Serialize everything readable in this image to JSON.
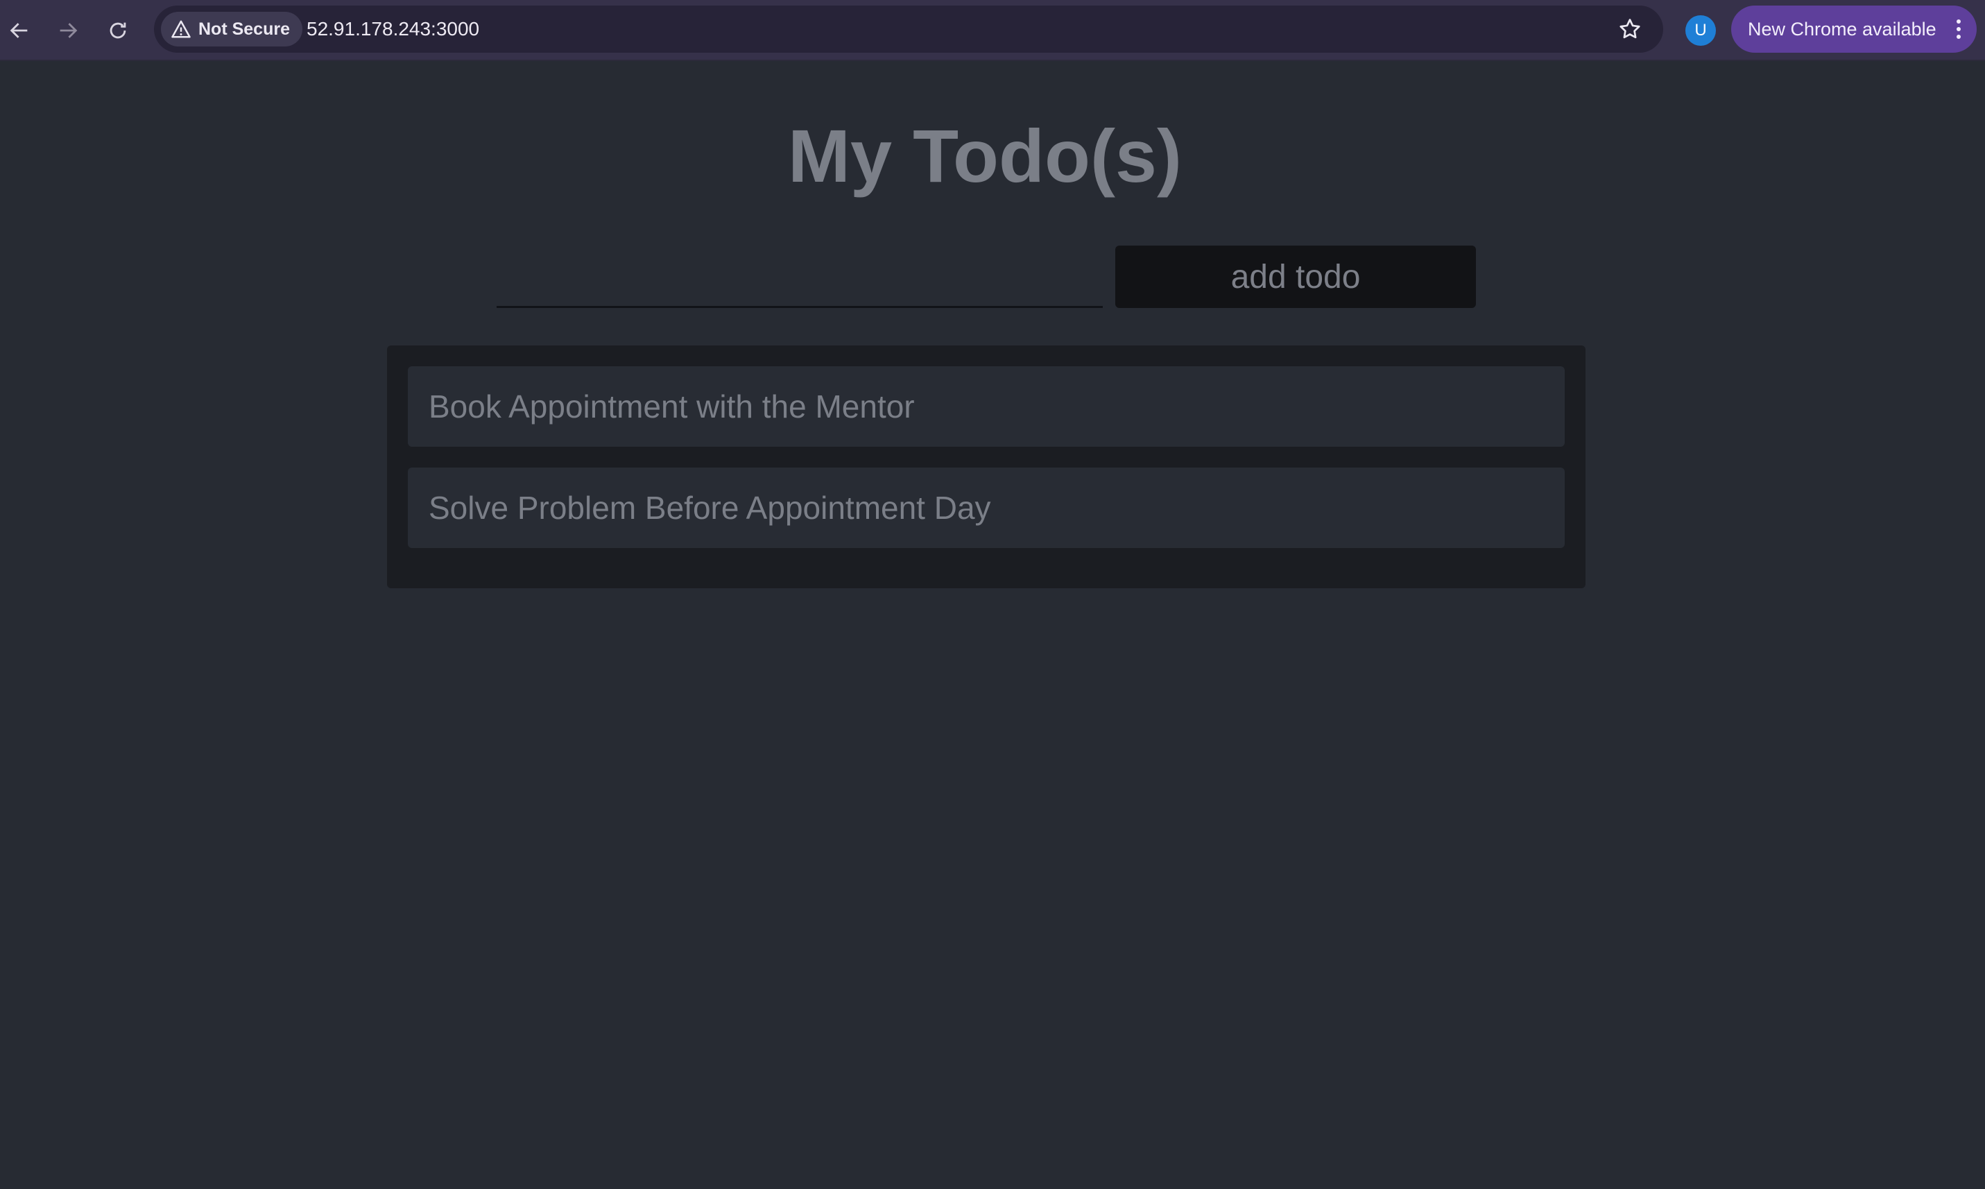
{
  "browser": {
    "security_label": "Not Secure",
    "url": "52.91.178.243:3000",
    "profile_initial": "U",
    "update_label": "New Chrome available"
  },
  "icons": {
    "back": "arrow-left-icon",
    "forward": "arrow-right-icon",
    "reload": "reload-icon",
    "security": "warning-triangle-icon",
    "bookmark": "star-icon",
    "menu": "kebab-menu-icon"
  },
  "colors": {
    "page_background": "#272b33",
    "panel_background": "#1b1d22",
    "item_background": "#282c34",
    "button_background": "#121316",
    "text": "#7b7f88",
    "update_chip": "#5e3f9b",
    "avatar": "#1f7fd6"
  },
  "app": {
    "title": "My Todo(s)",
    "input_value": "",
    "add_button_label": "add todo",
    "todos": [
      {
        "text": "Book Appointment with the Mentor"
      },
      {
        "text": "Solve Problem Before Appointment Day"
      }
    ]
  }
}
